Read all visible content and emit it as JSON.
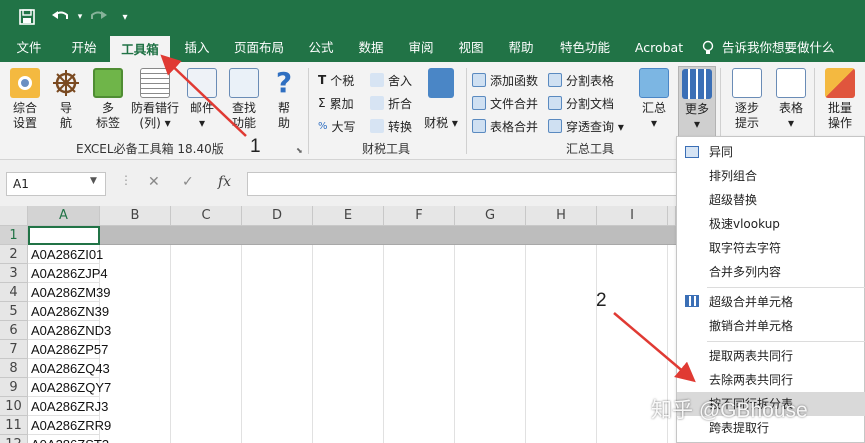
{
  "quick_access": {
    "save_icon": "save-icon",
    "undo_icon": "undo-icon",
    "redo_icon": "redo-icon",
    "customize_icon": "customize-arrow-icon"
  },
  "tabs": [
    "文件",
    "开始",
    "工具箱",
    "插入",
    "页面布局",
    "公式",
    "数据",
    "审阅",
    "视图",
    "帮助",
    "特色功能",
    "Acrobat"
  ],
  "active_tab": "工具箱",
  "tell_me": "告诉我你想要做什么",
  "ribbon": {
    "big_buttons": [
      {
        "label1": "综合",
        "label2": "设置"
      },
      {
        "label1": "导",
        "label2": "航"
      },
      {
        "label1": "多",
        "label2": "标签"
      },
      {
        "label1": "防看错行",
        "label2": "(列) ▾"
      },
      {
        "label1": "邮件",
        "label2": "▾"
      },
      {
        "label1": "查找",
        "label2": "功能"
      },
      {
        "label1": "帮",
        "label2": "助"
      }
    ],
    "group1_name": "EXCEL必备工具箱 18.40版",
    "finance": [
      {
        "icon": "T",
        "label": "个税"
      },
      {
        "icon": "Σ",
        "label": "累加"
      },
      {
        "icon": "%",
        "label": "大写"
      }
    ],
    "finance2": [
      {
        "icon": "舍",
        "label": "舍入"
      },
      {
        "icon": "折",
        "label": "折合"
      },
      {
        "icon": "ABC",
        "label": "转换"
      }
    ],
    "caiwu_label": "财税 ▾",
    "group2_name": "财税工具",
    "summary1": [
      "添加函数",
      "文件合并",
      "表格合并"
    ],
    "summary2": [
      "分割表格",
      "分割文档",
      "穿透查询 ▾"
    ],
    "huizong_label1": "汇总",
    "huizong_label2": "▾",
    "more_label1": "更多",
    "more_label2": "▾",
    "group3_name": "汇总工具",
    "step_label1": "逐步",
    "step_label2": "提示",
    "table_label1": "表格",
    "table_label2": "▾",
    "batch_label1": "批量",
    "batch_label2": "操作"
  },
  "formula_bar": {
    "cell_ref": "A1",
    "cancel": "✕",
    "confirm": "✓",
    "fx": "fx"
  },
  "columns": [
    "A",
    "B",
    "C",
    "D",
    "E",
    "F",
    "G",
    "H",
    "I"
  ],
  "rows": [
    {
      "n": "1",
      "a": ""
    },
    {
      "n": "2",
      "a": "A0A286ZI01"
    },
    {
      "n": "3",
      "a": "A0A286ZJP4"
    },
    {
      "n": "4",
      "a": "A0A286ZM39"
    },
    {
      "n": "5",
      "a": "A0A286ZN39"
    },
    {
      "n": "6",
      "a": "A0A286ZND3"
    },
    {
      "n": "7",
      "a": "A0A286ZP57"
    },
    {
      "n": "8",
      "a": "A0A286ZQ43"
    },
    {
      "n": "9",
      "a": "A0A286ZQY7"
    },
    {
      "n": "10",
      "a": "A0A286ZRJ3"
    },
    {
      "n": "11",
      "a": "A0A286ZRR9"
    },
    {
      "n": "12",
      "a": "A0A286ZST3"
    }
  ],
  "dropdown_items": [
    "异同",
    "排列组合",
    "超级替换",
    "极速vlookup",
    "取字符去字符",
    "合并多列内容",
    "超级合并单元格",
    "撤销合并单元格",
    "提取两表共同行",
    "去除两表共同行",
    "按不同行拆分表",
    "跨表提取行"
  ],
  "annotations": {
    "one": "1",
    "two": "2"
  },
  "watermark": "知乎 @GBhouse",
  "colors": {
    "excel_green": "#217346",
    "arrow_red": "#e03a33",
    "highlight": "#d9d9d9"
  }
}
